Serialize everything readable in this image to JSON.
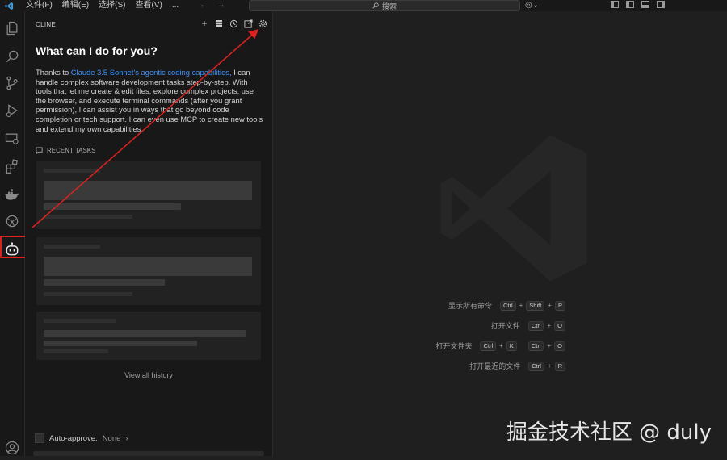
{
  "titlebar": {
    "menu": [
      "文件(F)",
      "编辑(E)",
      "选择(S)",
      "查看(V)",
      "..."
    ],
    "search_placeholder": "搜索",
    "copilot_label": "⌄"
  },
  "activity_bar": {
    "items": [
      "explorer-icon",
      "search-icon",
      "source-control-icon",
      "run-debug-icon",
      "remote-explorer-icon",
      "extensions-icon",
      "docker-icon",
      "ai-assistant-icon",
      "cline-icon",
      "account-icon"
    ]
  },
  "sidebar": {
    "header": "CLINE",
    "actions": [
      "plus-icon",
      "mcp-servers-icon",
      "history-icon",
      "popout-icon",
      "gear-icon"
    ],
    "welcome_title": "What can I do for you?",
    "welcome_prefix": "Thanks to ",
    "welcome_link": "Claude 3.5 Sonnet's agentic coding capabilities,",
    "welcome_rest": " I can handle complex software development tasks step-by-step. With tools that let me create & edit files, explore complex projects, use the browser, and execute terminal commands (after you grant permission), I can assist you in ways that go beyond code completion or tech support. I can even use MCP to create new tools and extend my own capabilities.",
    "recent_tasks_title": "RECENT TASKS",
    "view_all_history": "View all history",
    "auto_approve_label": "Auto-approve:",
    "auto_approve_value": "None",
    "auto_approve_chevron": "›"
  },
  "editor": {
    "shortcuts": [
      {
        "label": "显示所有命令",
        "keys": [
          [
            "Ctrl",
            "Shift",
            "P"
          ]
        ]
      },
      {
        "label": "打开文件",
        "keys": [
          [
            "Ctrl",
            "O"
          ]
        ]
      },
      {
        "label": "打开文件夹",
        "keys": [
          [
            "Ctrl",
            "K"
          ],
          [
            "Ctrl",
            "O"
          ]
        ]
      },
      {
        "label": "打开最近的文件",
        "keys": [
          [
            "Ctrl",
            "R"
          ]
        ]
      }
    ]
  },
  "watermark": "掘金技术社区 @ duly",
  "colors": {
    "accent_link": "#3794ff",
    "annotation_red": "#e02020",
    "background": "#1f1f1f",
    "sidebar": "#181818"
  }
}
